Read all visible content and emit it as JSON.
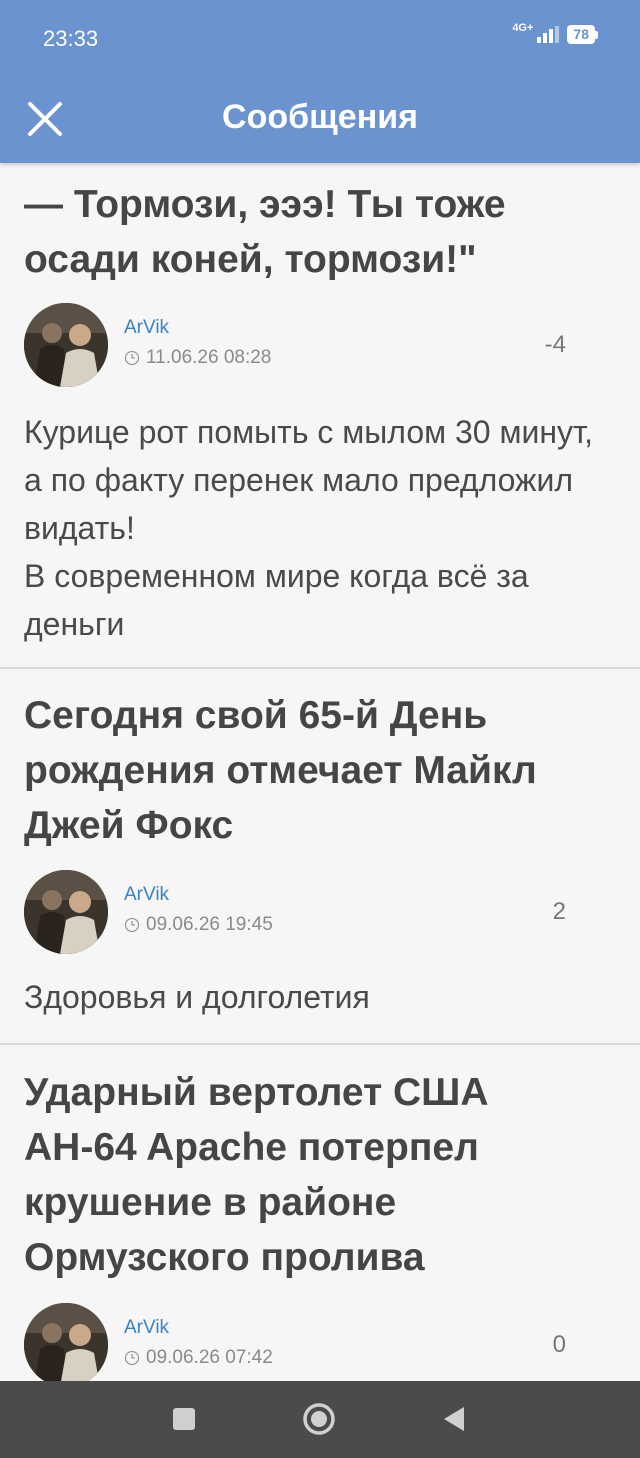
{
  "status": {
    "time": "23:33",
    "network": "4G+",
    "battery": "78"
  },
  "header": {
    "title": "Сообщения",
    "close_icon": "close-icon"
  },
  "posts": [
    {
      "title_lines": [
        "— Тормози, эээ! Ты тоже",
        "осади коней, тормози!\""
      ],
      "author": "ArVik",
      "date": "11.06.26 08:28",
      "rating": "-4",
      "body_lines": [
        "Курице рот помыть с мылом 30 минут, а по факту перенек мало предложил видать!",
        "В современном мире когда всё за деньги"
      ]
    },
    {
      "title_lines": [
        "Сегодня свой 65-й День",
        "рождения отмечает Майкл",
        "Джей Фокс"
      ],
      "author": "ArVik",
      "date": "09.06.26 19:45",
      "rating": "2",
      "body_lines": [
        "Здоровья и долголетия"
      ]
    },
    {
      "title_lines": [
        "Ударный вертолет США",
        "AH-64 Apache потерпел",
        "крушение в районе",
        "Ормузского пролива"
      ],
      "author": "ArVik",
      "date": "09.06.26 07:42",
      "rating": "0",
      "body_lines": []
    }
  ],
  "nav": {
    "recents": "square-icon",
    "home": "circle-icon",
    "back": "triangle-back-icon"
  },
  "colors": {
    "header_bg": "#6a93cf",
    "author": "#3a83c5",
    "navbar": "#4b4b4b"
  }
}
